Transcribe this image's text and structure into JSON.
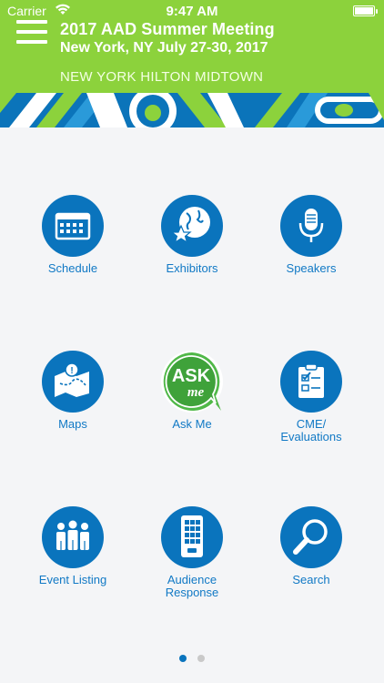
{
  "status_bar": {
    "carrier": "Carrier",
    "time": "9:47 AM"
  },
  "header": {
    "title": "2017 AAD Summer Meeting",
    "subtitle": "New York, NY   July 27-30, 2017",
    "venue": "NEW YORK HILTON MIDTOWN",
    "brand_color": "#8cd23c"
  },
  "grid": {
    "accent_color": "#0a74bd",
    "items": [
      {
        "label": "Schedule",
        "icon": "calendar-icon"
      },
      {
        "label": "Exhibitors",
        "icon": "globe-star-icon"
      },
      {
        "label": "Speakers",
        "icon": "microphone-icon"
      },
      {
        "label": "Maps",
        "icon": "map-icon"
      },
      {
        "label": "Ask Me",
        "icon": "ask-me-icon"
      },
      {
        "label": "CME/\nEvaluations",
        "icon": "clipboard-checklist-icon"
      },
      {
        "label": "Event Listing",
        "icon": "people-group-icon"
      },
      {
        "label": "Audience\nResponse",
        "icon": "keypad-device-icon"
      },
      {
        "label": "Search",
        "icon": "magnifier-icon"
      }
    ]
  },
  "pager": {
    "pages": 2,
    "current": 1
  }
}
